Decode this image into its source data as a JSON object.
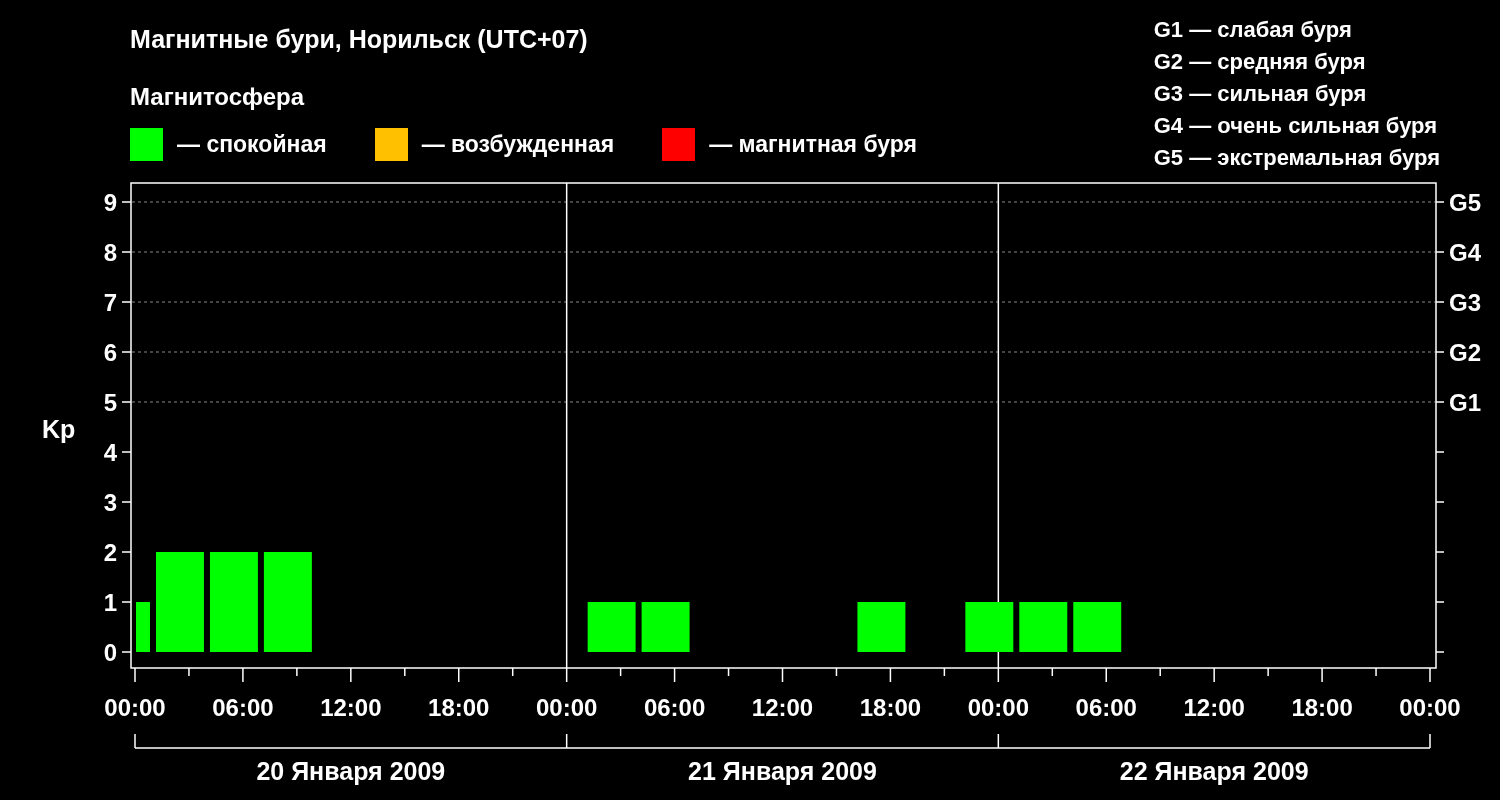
{
  "title": "Магнитные бури, Норильск (UTC+07)",
  "magnetosphere": {
    "heading": "Магнитосфера",
    "legend": [
      {
        "label": "— спокойная",
        "color": "#00ff00"
      },
      {
        "label": "— возбужденная",
        "color": "#ffc000"
      },
      {
        "label": "— магнитная буря",
        "color": "#ff0000"
      }
    ]
  },
  "storm_scale": [
    "G1 — слабая буря",
    "G2 — средняя буря",
    "G3 — сильная буря",
    "G4 — очень сильная буря",
    "G5 — экстремальная буря"
  ],
  "chart": {
    "chart_data": {
      "type": "bar",
      "ylabel": "Kp",
      "ylim": [
        -0.32,
        9.38
      ],
      "yticks": [
        0,
        1,
        2,
        3,
        4,
        5,
        6,
        7,
        8,
        9
      ],
      "grid": true,
      "xlim": [
        "2009-01-20T00:00",
        "2009-01-23T00:00"
      ],
      "x": [
        "2009-01-20T00:30",
        "2009-01-20T02:30",
        "2009-01-20T05:30",
        "2009-01-20T08:30",
        "2009-01-20T11:30",
        "2009-01-20T14:30",
        "2009-01-20T17:30",
        "2009-01-20T20:30",
        "2009-01-20T23:30",
        "2009-01-21T02:30",
        "2009-01-21T05:30",
        "2009-01-21T08:30",
        "2009-01-21T11:30",
        "2009-01-21T14:30",
        "2009-01-21T17:30",
        "2009-01-21T20:30",
        "2009-01-21T23:30",
        "2009-01-22T02:30",
        "2009-01-22T05:30",
        "2009-01-22T08:30",
        "2009-01-22T11:30",
        "2009-01-22T14:30",
        "2009-01-22T17:30",
        "2009-01-22T20:30",
        "2009-01-22T23:00"
      ],
      "series": [
        {
          "values": [
            1,
            2,
            2,
            2,
            0,
            0,
            0,
            0,
            0,
            1,
            1,
            0,
            0,
            0,
            1,
            0,
            1,
            1,
            1,
            0,
            0,
            0,
            0,
            0,
            0
          ]
        }
      ],
      "xticks": [
        {
          "value": "2009-01-20T00:00",
          "label": "00:00"
        },
        {
          "value": "2009-01-20T06:00",
          "label": "06:00"
        },
        {
          "value": "2009-01-20T12:00",
          "label": "12:00"
        },
        {
          "value": "2009-01-20T18:00",
          "label": "18:00"
        },
        {
          "value": "2009-01-21T00:00",
          "label": "00:00"
        },
        {
          "value": "2009-01-21T06:00",
          "label": "06:00"
        },
        {
          "value": "2009-01-21T12:00",
          "label": "12:00"
        },
        {
          "value": "2009-01-21T18:00",
          "label": "18:00"
        },
        {
          "value": "2009-01-22T00:00",
          "label": "00:00"
        },
        {
          "value": "2009-01-22T06:00",
          "label": "06:00"
        },
        {
          "value": "2009-01-22T12:00",
          "label": "12:00"
        },
        {
          "value": "2009-01-22T18:00",
          "label": "18:00"
        },
        {
          "value": "2009-01-23T00:00",
          "label": "00:00"
        }
      ]
    },
    "storm_levels": [
      "G5",
      "G4",
      "G3",
      "G2",
      "G1"
    ],
    "days": [
      "20 Января 2009",
      "21 Января 2009",
      "22 Января 2009"
    ]
  }
}
